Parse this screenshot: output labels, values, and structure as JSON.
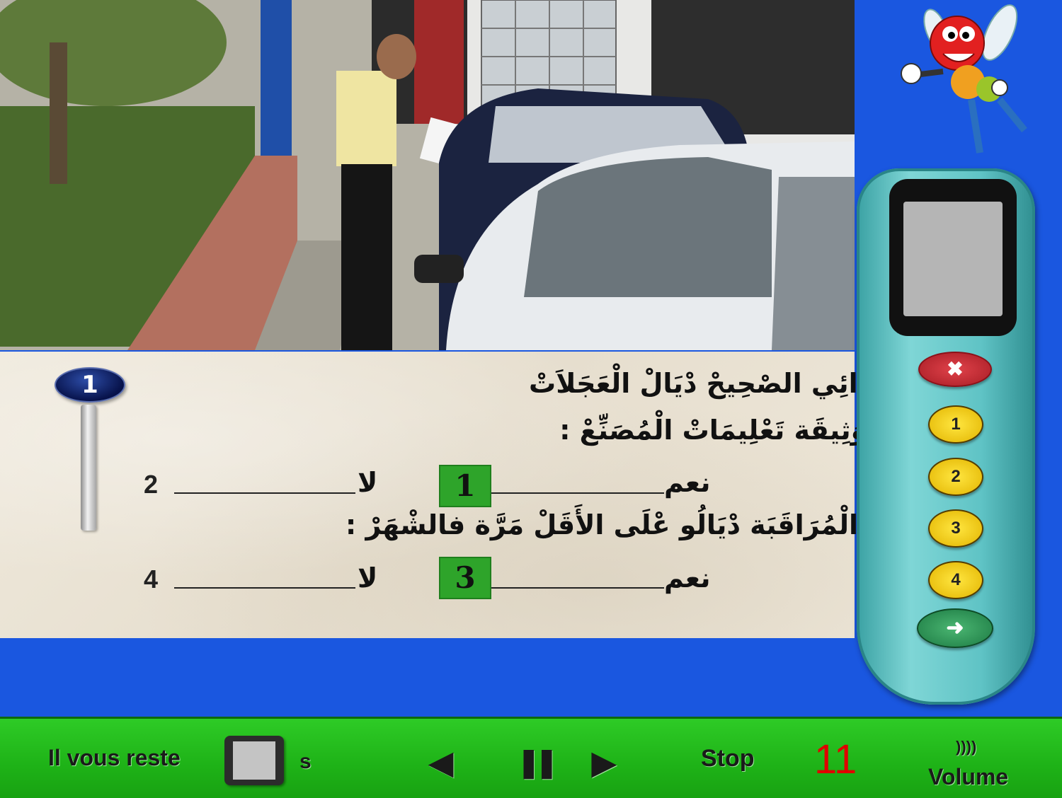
{
  "question": {
    "number": "1",
    "line1": "الضَّغْطْ الهَوَائِي الصْحِيحْ دْيَالْ الْعَجَلاَتْ",
    "line2": "مَشار لِيه فْوَثِيقَة تَعْلِيمَاتْ الْمُصَنِّعْ :",
    "line4": "مَنْ الوَاجَبْ الْمُرَاقَبَة دْيَالُو عْلَى الأَقَلْ مَرَّة فالشْهَرْ :",
    "answers": [
      {
        "yes_label": "نعم",
        "yes_value": "1",
        "no_label": "لا",
        "no_value": "2"
      },
      {
        "yes_label": "نعم",
        "yes_value": "3",
        "no_label": "لا",
        "no_value": "4"
      }
    ]
  },
  "remote": {
    "cancel_label": "✖",
    "buttons": [
      "1",
      "2",
      "3",
      "4"
    ],
    "next_label": "➜"
  },
  "bottom_bar": {
    "time_label": "Il vous reste",
    "time_unit": "s",
    "prev_label": "◀",
    "pause_label": "❚❚",
    "next_label": "▶",
    "stop_label": "Stop",
    "counter": "11",
    "volume_label": "Volume",
    "volume_icon": "))))"
  },
  "colors": {
    "background": "#1a57e0",
    "bottom_bar": "#1eb217",
    "answer_badge": "#2ea42a",
    "counter": "#e00000"
  }
}
